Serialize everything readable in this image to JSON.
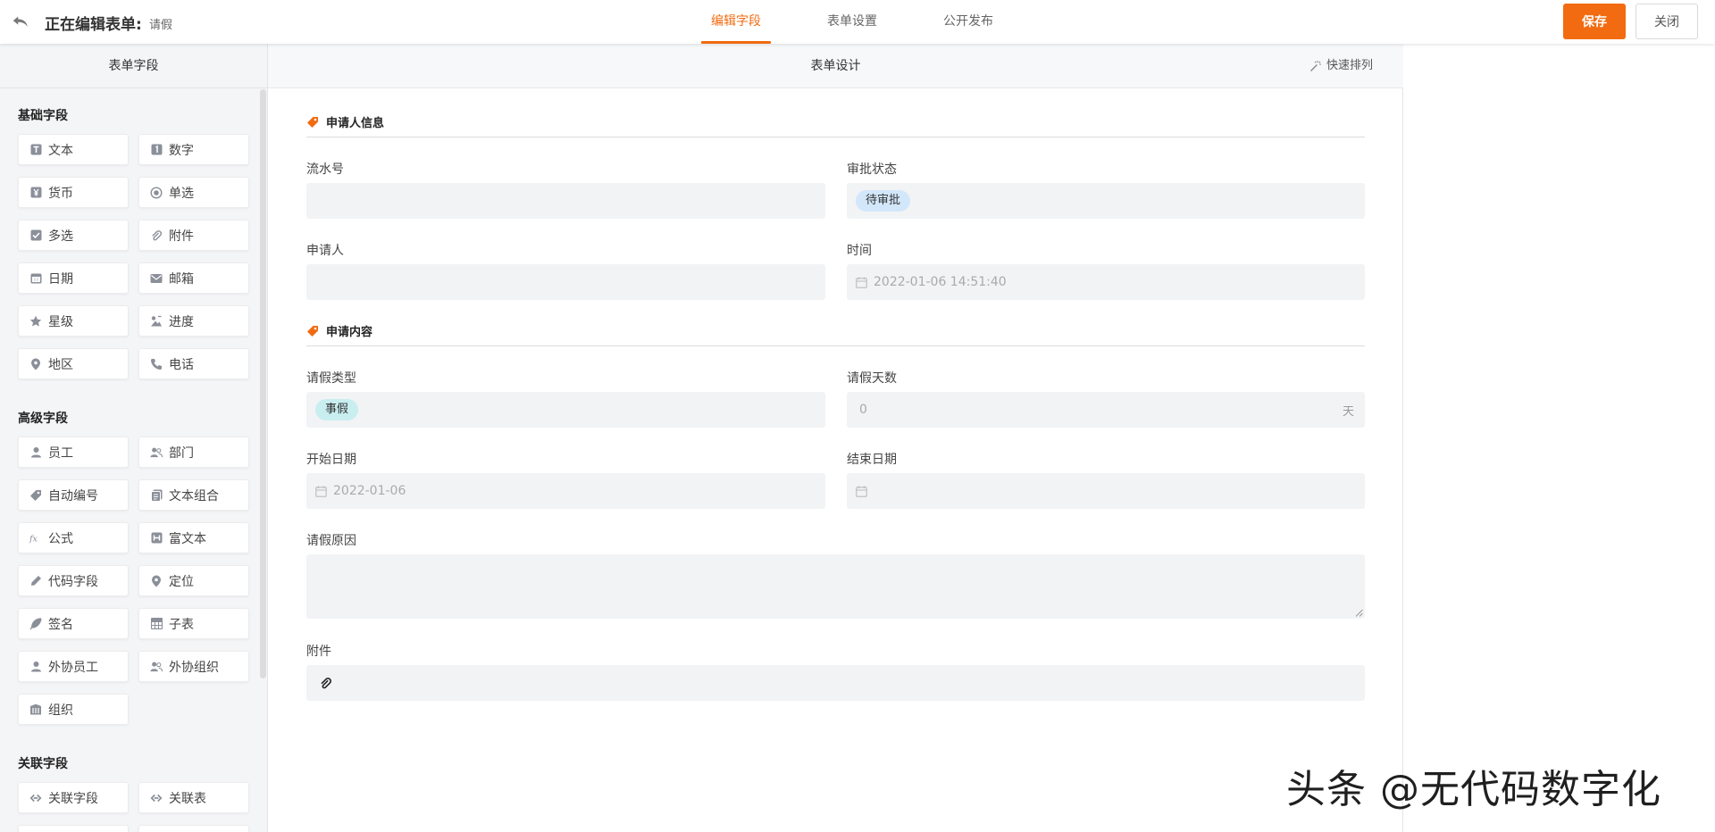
{
  "header": {
    "editing_prefix": "正在编辑表单:",
    "form_name": "请假",
    "tabs": [
      {
        "label": "编辑字段",
        "active": true
      },
      {
        "label": "表单设置",
        "active": false
      },
      {
        "label": "公开发布",
        "active": false
      }
    ],
    "save_label": "保存",
    "close_label": "关闭",
    "accent_color": "#f26b10"
  },
  "left": {
    "title": "表单字段",
    "groups": [
      {
        "title": "基础字段",
        "items": [
          {
            "label": "文本",
            "icon": "text-icon"
          },
          {
            "label": "数字",
            "icon": "number-icon"
          },
          {
            "label": "货币",
            "icon": "currency-icon"
          },
          {
            "label": "单选",
            "icon": "radio-icon"
          },
          {
            "label": "多选",
            "icon": "checkbox-icon"
          },
          {
            "label": "附件",
            "icon": "paperclip-icon"
          },
          {
            "label": "日期",
            "icon": "calendar-icon"
          },
          {
            "label": "邮箱",
            "icon": "mail-icon"
          },
          {
            "label": "星级",
            "icon": "star-icon"
          },
          {
            "label": "进度",
            "icon": "progress-icon"
          },
          {
            "label": "地区",
            "icon": "location-pin-icon"
          },
          {
            "label": "电话",
            "icon": "phone-icon"
          }
        ]
      },
      {
        "title": "高级字段",
        "items": [
          {
            "label": "员工",
            "icon": "user-icon"
          },
          {
            "label": "部门",
            "icon": "users-icon"
          },
          {
            "label": "自动编号",
            "icon": "tag-icon"
          },
          {
            "label": "文本组合",
            "icon": "text-combine-icon"
          },
          {
            "label": "公式",
            "icon": "formula-icon"
          },
          {
            "label": "富文本",
            "icon": "rich-text-icon"
          },
          {
            "label": "代码字段",
            "icon": "pencil-icon"
          },
          {
            "label": "定位",
            "icon": "location-pin-icon"
          },
          {
            "label": "签名",
            "icon": "feather-icon"
          },
          {
            "label": "子表",
            "icon": "table-icon"
          },
          {
            "label": "外协员工",
            "icon": "user-icon"
          },
          {
            "label": "外协组织",
            "icon": "users-icon"
          },
          {
            "label": "组织",
            "icon": "building-icon"
          }
        ]
      },
      {
        "title": "关联字段",
        "items": [
          {
            "label": "关联字段",
            "icon": "link-icon"
          },
          {
            "label": "关联表",
            "icon": "link-icon"
          }
        ]
      }
    ]
  },
  "center": {
    "title": "表单设计",
    "quick_sort_label": "快速排列",
    "sections": [
      {
        "title": "申请人信息"
      },
      {
        "title": "申请内容"
      }
    ],
    "fields": {
      "serial": {
        "label": "流水号",
        "value": ""
      },
      "status": {
        "label": "审批状态",
        "value": "待审批"
      },
      "applicant": {
        "label": "申请人",
        "value": ""
      },
      "time": {
        "label": "时间",
        "value": "2022-01-06 14:51:40"
      },
      "leave_type": {
        "label": "请假类型",
        "value": "事假"
      },
      "leave_days": {
        "label": "请假天数",
        "value": "0",
        "unit": "天"
      },
      "start_date": {
        "label": "开始日期",
        "value": "2022-01-06"
      },
      "end_date": {
        "label": "结束日期",
        "value": ""
      },
      "reason": {
        "label": "请假原因",
        "value": ""
      },
      "attachment": {
        "label": "附件"
      }
    }
  },
  "watermark": "头条 @无代码数字化"
}
